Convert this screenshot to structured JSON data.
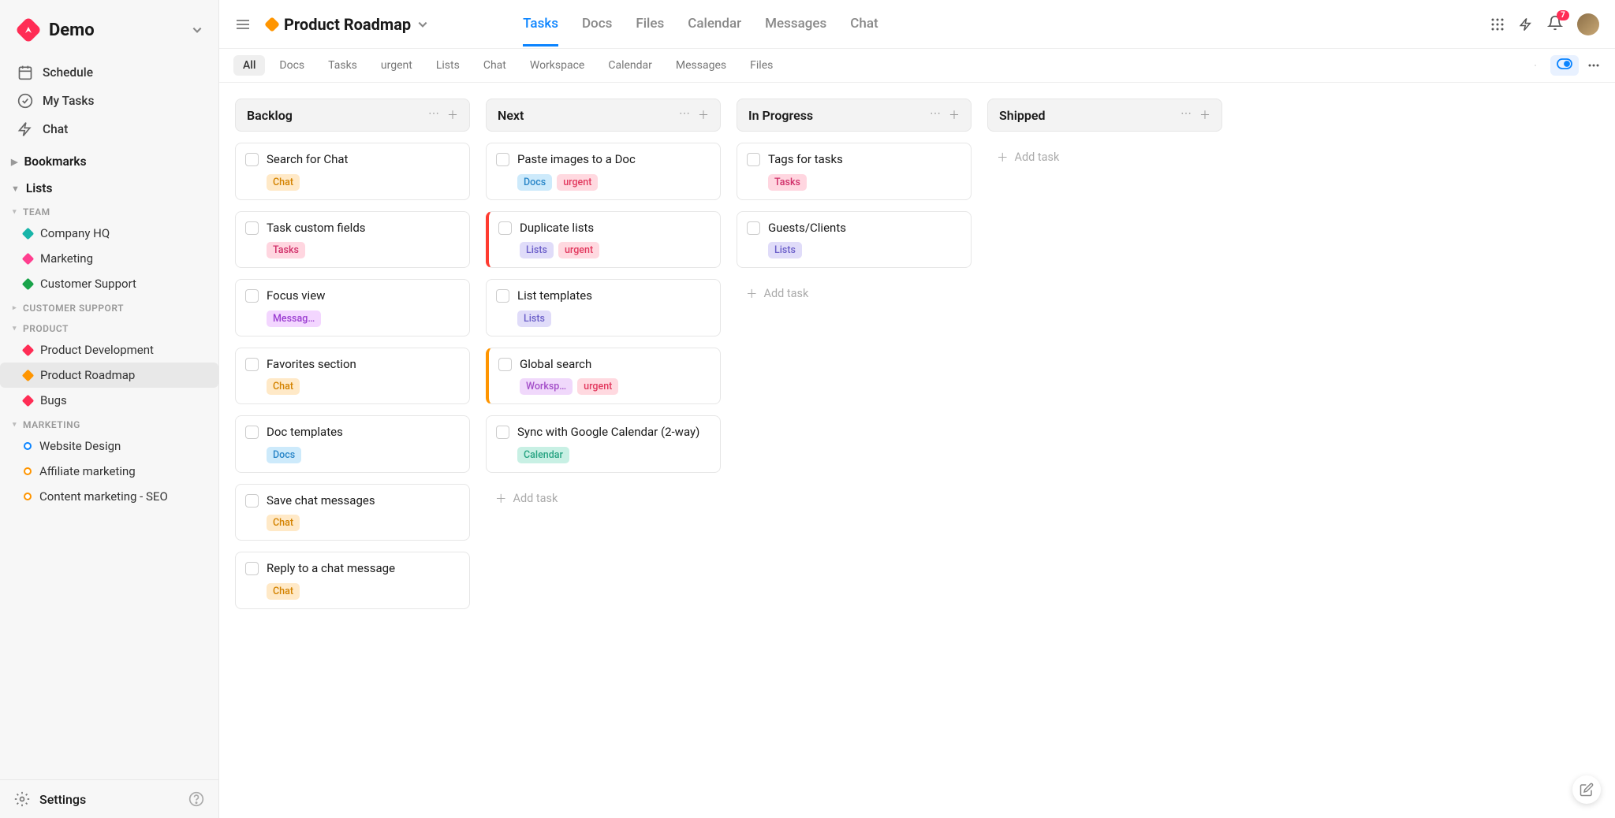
{
  "workspace": {
    "name": "Demo"
  },
  "sidebar": {
    "nav": [
      {
        "label": "Schedule",
        "icon": "calendar"
      },
      {
        "label": "My Tasks",
        "icon": "check-circle"
      },
      {
        "label": "Chat",
        "icon": "bolt"
      }
    ],
    "bookmarks_label": "Bookmarks",
    "lists_label": "Lists",
    "groups": [
      {
        "name": "TEAM",
        "expanded": true,
        "items": [
          {
            "label": "Company HQ",
            "color": "#18b5a9",
            "shape": "diamond"
          },
          {
            "label": "Marketing",
            "color": "#ff3f8f",
            "shape": "diamond"
          },
          {
            "label": "Customer Support",
            "color": "#1aa34a",
            "shape": "diamond"
          }
        ]
      },
      {
        "name": "CUSTOMER SUPPORT",
        "expanded": false,
        "items": []
      },
      {
        "name": "PRODUCT",
        "expanded": true,
        "items": [
          {
            "label": "Product Development",
            "color": "#ff2d55",
            "shape": "diamond"
          },
          {
            "label": "Product Roadmap",
            "color": "#ff9500",
            "shape": "diamond",
            "active": true
          },
          {
            "label": "Bugs",
            "color": "#ff2d55",
            "shape": "diamond"
          }
        ]
      },
      {
        "name": "MARKETING",
        "expanded": true,
        "items": [
          {
            "label": "Website Design",
            "color": "#0b84ff",
            "shape": "circle"
          },
          {
            "label": "Affiliate marketing",
            "color": "#ff9500",
            "shape": "circle"
          },
          {
            "label": "Content marketing - SEO",
            "color": "#ff9500",
            "shape": "circle"
          }
        ]
      }
    ],
    "settings_label": "Settings"
  },
  "header": {
    "title": "Product Roadmap",
    "color": "#ff9500",
    "tabs": [
      "Tasks",
      "Docs",
      "Files",
      "Calendar",
      "Messages",
      "Chat"
    ],
    "active_tab": 0,
    "notification_count": "7"
  },
  "filters": {
    "chips": [
      "All",
      "Docs",
      "Tasks",
      "urgent",
      "Lists",
      "Chat",
      "Workspace",
      "Calendar",
      "Messages",
      "Files"
    ],
    "active": 0
  },
  "board": {
    "add_task_label": "Add task",
    "columns": [
      {
        "title": "Backlog",
        "cards": [
          {
            "title": "Search for Chat",
            "tags": [
              {
                "text": "Chat",
                "cls": "tag-chat"
              }
            ]
          },
          {
            "title": "Task custom fields",
            "tags": [
              {
                "text": "Tasks",
                "cls": "tag-tasks"
              }
            ]
          },
          {
            "title": "Focus view",
            "tags": [
              {
                "text": "Messag…",
                "cls": "tag-messages"
              }
            ]
          },
          {
            "title": "Favorites section",
            "tags": [
              {
                "text": "Chat",
                "cls": "tag-chat"
              }
            ]
          },
          {
            "title": "Doc templates",
            "tags": [
              {
                "text": "Docs",
                "cls": "tag-docs"
              }
            ]
          },
          {
            "title": "Save chat messages",
            "tags": [
              {
                "text": "Chat",
                "cls": "tag-chat"
              }
            ]
          },
          {
            "title": "Reply to a chat message",
            "tags": [
              {
                "text": "Chat",
                "cls": "tag-chat"
              }
            ]
          }
        ]
      },
      {
        "title": "Next",
        "cards": [
          {
            "title": "Paste images to a Doc",
            "tags": [
              {
                "text": "Docs",
                "cls": "tag-docs"
              },
              {
                "text": "urgent",
                "cls": "tag-urgent"
              }
            ]
          },
          {
            "title": "Duplicate lists",
            "priority": "red",
            "tags": [
              {
                "text": "Lists",
                "cls": "tag-lists"
              },
              {
                "text": "urgent",
                "cls": "tag-urgent"
              }
            ]
          },
          {
            "title": "List templates",
            "tags": [
              {
                "text": "Lists",
                "cls": "tag-lists"
              }
            ]
          },
          {
            "title": "Global search",
            "priority": "orange",
            "tags": [
              {
                "text": "Worksp…",
                "cls": "tag-workspace"
              },
              {
                "text": "urgent",
                "cls": "tag-urgent"
              }
            ]
          },
          {
            "title": "Sync with Google Calendar (2-way)",
            "tags": [
              {
                "text": "Calendar",
                "cls": "tag-calendar"
              }
            ]
          }
        ],
        "show_add": true
      },
      {
        "title": "In Progress",
        "cards": [
          {
            "title": "Tags for tasks",
            "tags": [
              {
                "text": "Tasks",
                "cls": "tag-tasks"
              }
            ]
          },
          {
            "title": "Guests/Clients",
            "tags": [
              {
                "text": "Lists",
                "cls": "tag-lists"
              }
            ]
          }
        ],
        "show_add": true
      },
      {
        "title": "Shipped",
        "cards": [],
        "show_add": true
      }
    ]
  }
}
